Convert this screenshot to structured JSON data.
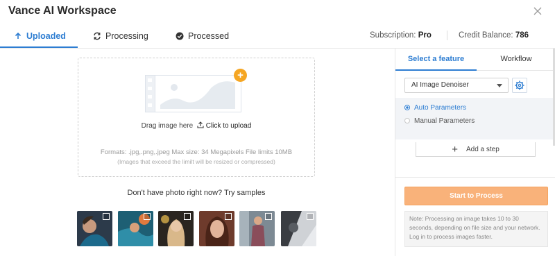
{
  "app": {
    "title": "Vance AI Workspace"
  },
  "tabs": [
    {
      "label": "Uploaded",
      "icon": "upload-arrow-icon",
      "active": true
    },
    {
      "label": "Processing",
      "icon": "refresh-icon",
      "active": false
    },
    {
      "label": "Processed",
      "icon": "check-circle-icon",
      "active": false
    }
  ],
  "account": {
    "subscription_label": "Subscription:",
    "subscription_value": "Pro",
    "credit_label": "Credit Balance:",
    "credit_value": "786"
  },
  "upload": {
    "drag_text": "Drag image here",
    "click_text": "Click to upload",
    "formats": "Formats: .jpg,.png,.jpeg Max size: 34 Megapixels File limits 10MB",
    "resize_note": "(Images that exceed the limilt will be resized or compressed)"
  },
  "samples": {
    "title": "Don't have photo right now? Try samples",
    "items": [
      "sample-1",
      "sample-2",
      "sample-3",
      "sample-4",
      "sample-5",
      "sample-6"
    ]
  },
  "panel": {
    "tabs": [
      {
        "label": "Select a feature",
        "active": true
      },
      {
        "label": "Workflow",
        "active": false
      }
    ],
    "feature_select": "AI Image Denoiser",
    "params": [
      {
        "label": "Auto Parameters",
        "selected": true
      },
      {
        "label": "Manual Parameters",
        "selected": false
      }
    ],
    "add_step": "Add a step",
    "start_button": "Start to Process",
    "note": "Note: Processing an image takes 10 to 30 seconds, depending on file size and your network. Log in to process images faster."
  },
  "colors": {
    "accent": "#2d7dd2",
    "start_button": "#f9b27a",
    "badge": "#f5a623"
  }
}
